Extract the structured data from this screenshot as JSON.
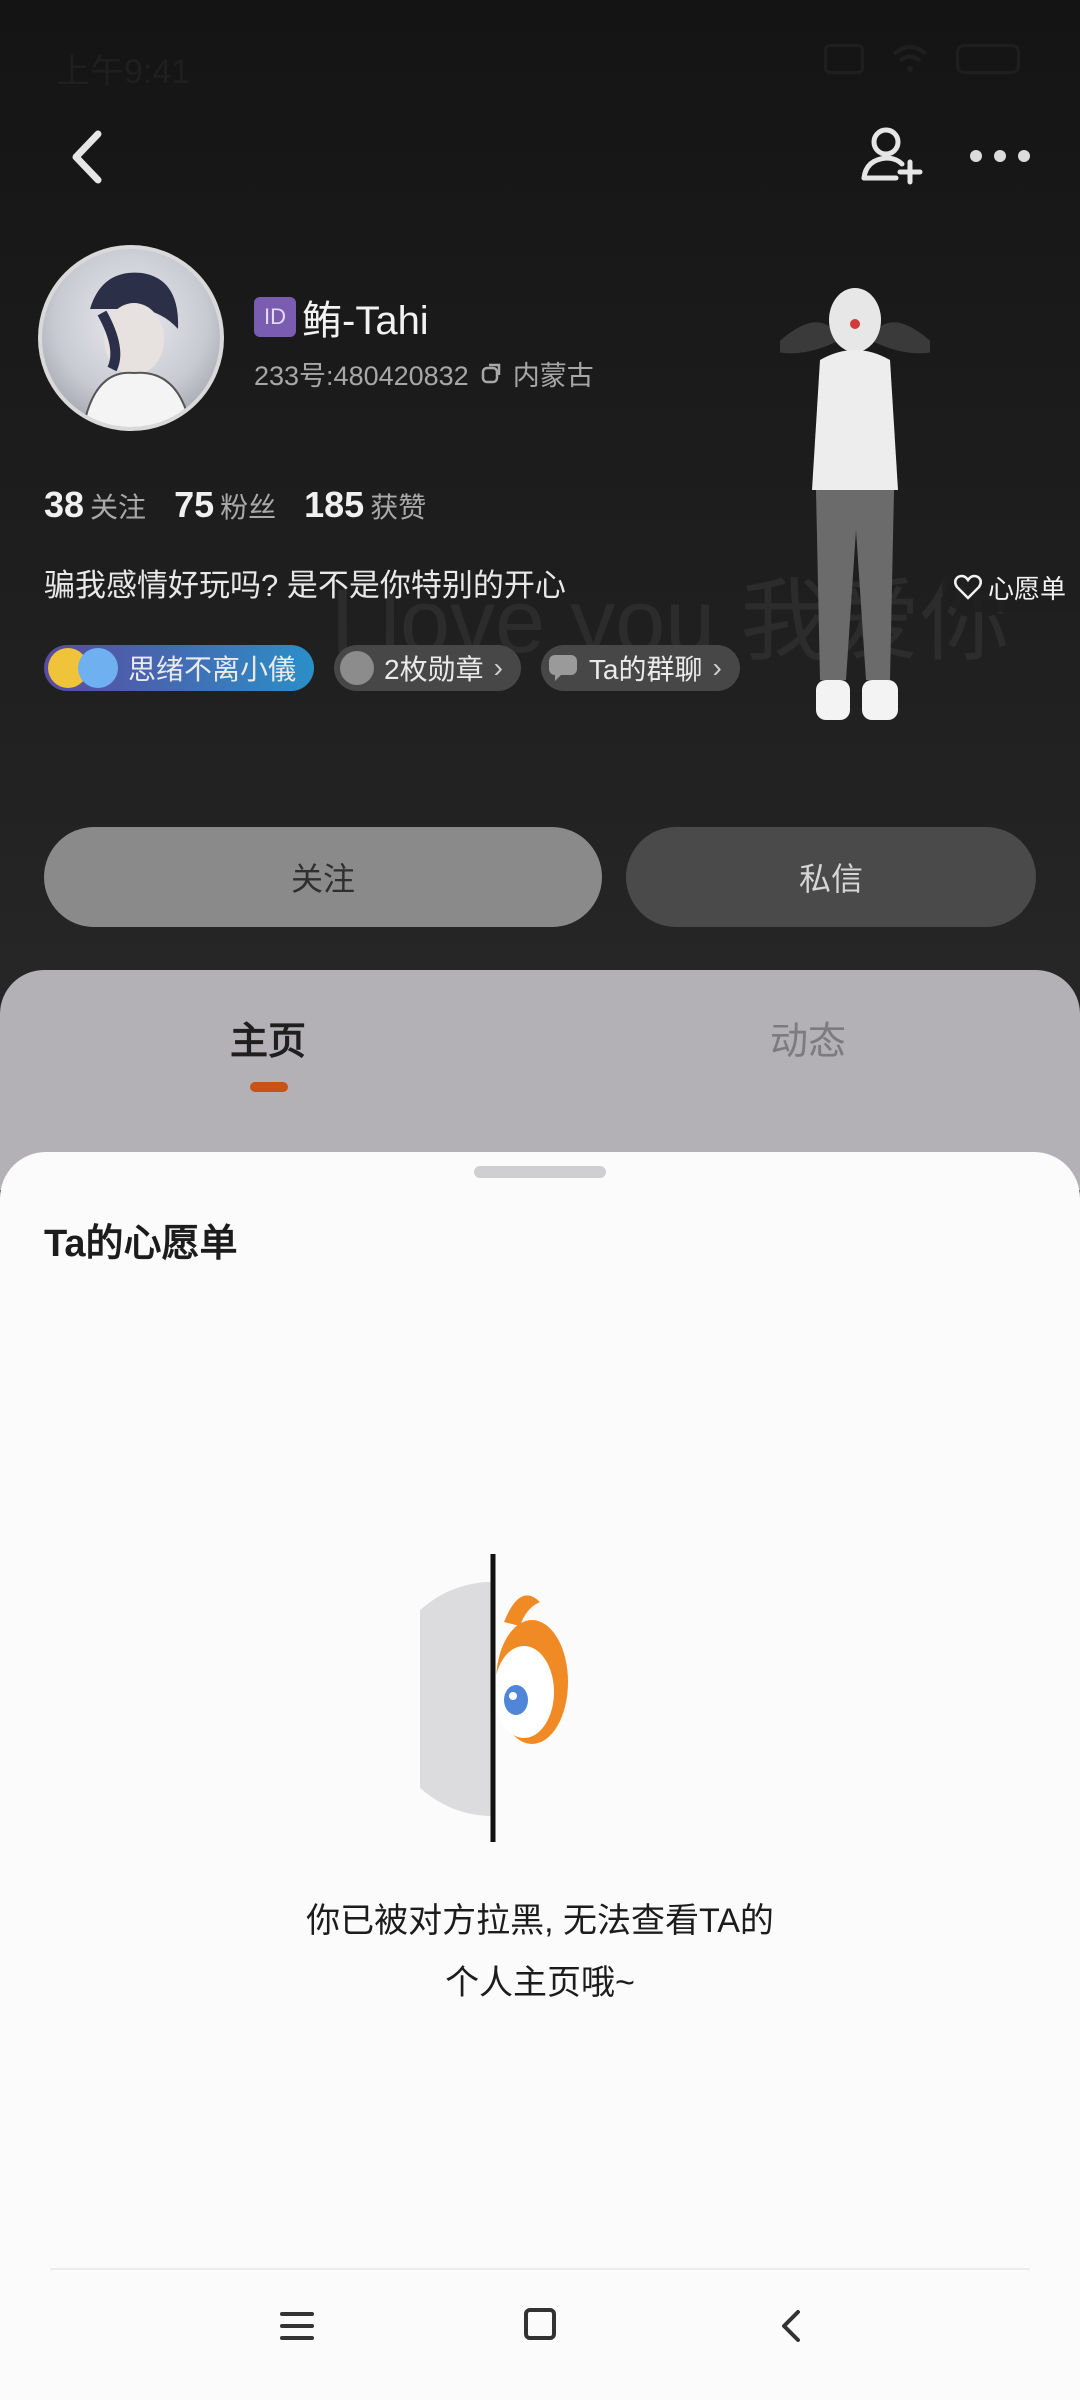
{
  "status_bar": {
    "time": "上午9:41",
    "icons": [
      "clock-icon",
      "sim-icon",
      "wifi-icon",
      "battery-icon"
    ]
  },
  "nav": {
    "back_icon": "back-chevron-icon",
    "add_friend_icon": "add-friend-icon",
    "more_icon": "more-dots-icon"
  },
  "profile": {
    "id_badge": "ID",
    "nickname": "鲔-Tahi",
    "account": "233号:480420832",
    "location": "内蒙古",
    "stats": [
      {
        "value": "38",
        "label": "关注"
      },
      {
        "value": "75",
        "label": "粉丝"
      },
      {
        "value": "185",
        "label": "获赞"
      }
    ],
    "bio": "骗我感情好玩吗? 是不是你特别的开心",
    "watermark": "I love you 我爱你",
    "chips": {
      "badge": "思绪不离小儀",
      "medals": "2枚勋章",
      "group": "Ta的群聊"
    },
    "wishlist_label": "心愿单"
  },
  "actions": {
    "follow": "关注",
    "message": "私信"
  },
  "tabs": {
    "home": "主页",
    "dynamic": "动态"
  },
  "sheet": {
    "title": "Ta的心愿单",
    "blocked_line1": "你已被对方拉黑, 无法查看TA的",
    "blocked_line2": "个人主页哦~"
  },
  "colors": {
    "accent": "#c75316",
    "id_badge": "#7a5cb0"
  }
}
